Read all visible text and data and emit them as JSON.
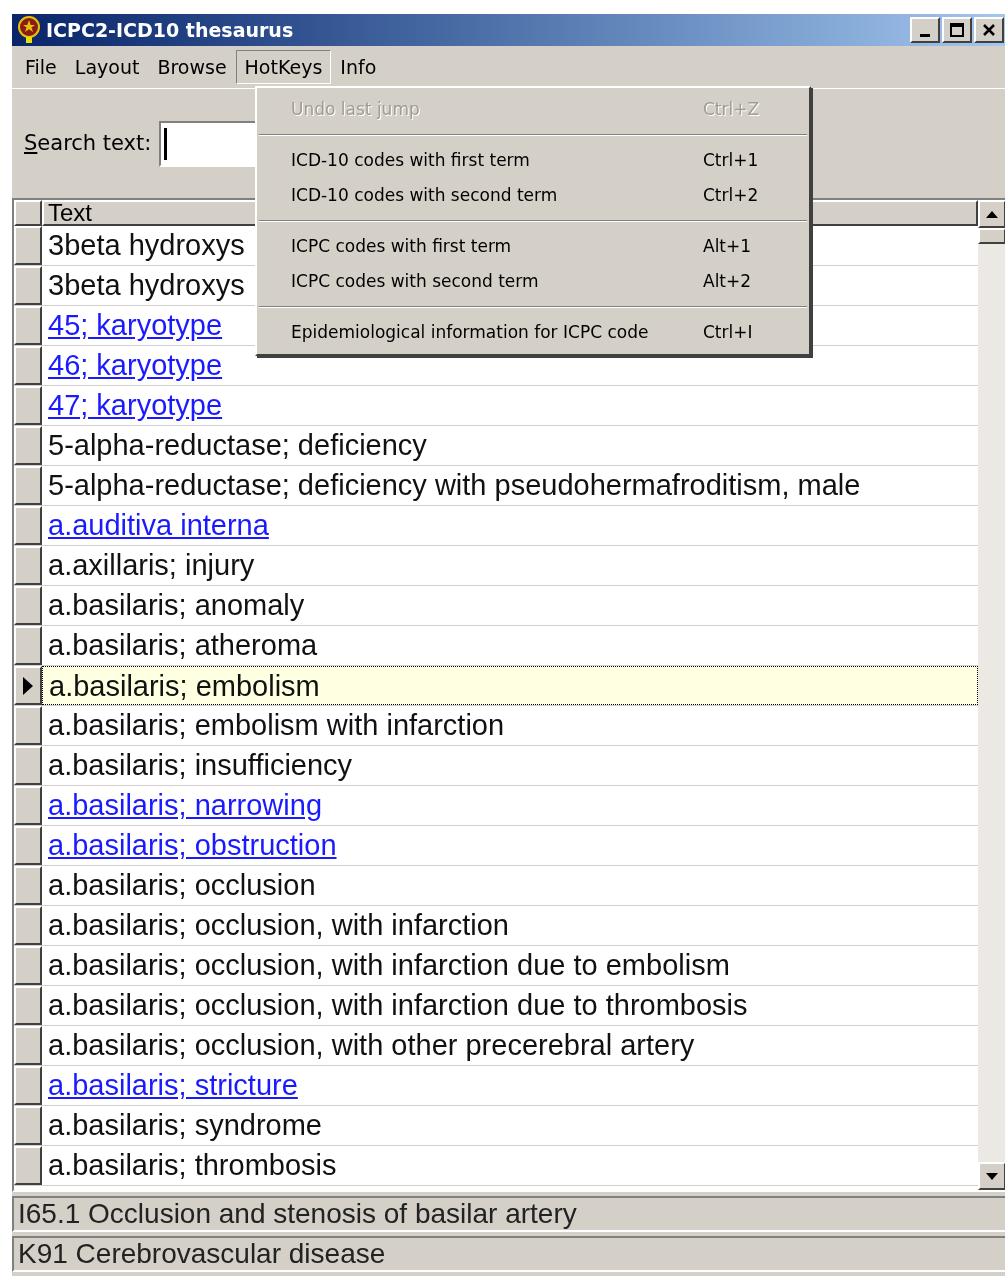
{
  "window": {
    "title": "ICPC2-ICD10 thesaurus"
  },
  "menu_bar": [
    {
      "label": "File",
      "selected": false
    },
    {
      "label": "Layout",
      "selected": false
    },
    {
      "label": "Browse",
      "selected": false
    },
    {
      "label": "HotKeys",
      "selected": true
    },
    {
      "label": "Info",
      "selected": false
    }
  ],
  "hotkeys_menu": [
    {
      "kind": "item",
      "label": "Undo last jump",
      "shortcut": "Ctrl+Z",
      "disabled": true
    },
    {
      "kind": "separator"
    },
    {
      "kind": "item",
      "label": "ICD-10 codes with first term",
      "shortcut": "Ctrl+1",
      "disabled": false
    },
    {
      "kind": "item",
      "label": "ICD-10 codes with second term",
      "shortcut": "Ctrl+2",
      "disabled": false
    },
    {
      "kind": "separator"
    },
    {
      "kind": "item",
      "label": "ICPC codes with first term",
      "shortcut": "Alt+1",
      "disabled": false
    },
    {
      "kind": "item",
      "label": "ICPC codes with second term",
      "shortcut": "Alt+2",
      "disabled": false
    },
    {
      "kind": "separator"
    },
    {
      "kind": "item",
      "label": "Epidemiological information for ICPC code",
      "shortcut": "Ctrl+I",
      "disabled": false
    }
  ],
  "search": {
    "label_accel": "S",
    "label_rest": "earch text:"
  },
  "table": {
    "columns": [
      "Text"
    ],
    "rows": [
      {
        "text": "3beta hydroxys",
        "kind": "plain",
        "selected": false
      },
      {
        "text": "3beta hydroxys",
        "kind": "plain",
        "selected": false
      },
      {
        "text": "45; karyotype",
        "kind": "link",
        "selected": false
      },
      {
        "text": "46; karyotype",
        "kind": "link",
        "selected": false
      },
      {
        "text": "47; karyotype",
        "kind": "link",
        "selected": false
      },
      {
        "text": "5-alpha-reductase; deficiency",
        "kind": "plain",
        "selected": false
      },
      {
        "text": "5-alpha-reductase; deficiency with pseudohermafroditism, male",
        "kind": "plain",
        "selected": false
      },
      {
        "text": "a.auditiva interna",
        "kind": "link",
        "selected": false
      },
      {
        "text": "a.axillaris; injury",
        "kind": "plain",
        "selected": false
      },
      {
        "text": "a.basilaris; anomaly",
        "kind": "plain",
        "selected": false
      },
      {
        "text": "a.basilaris; atheroma",
        "kind": "plain",
        "selected": false
      },
      {
        "text": "a.basilaris; embolism",
        "kind": "plain",
        "selected": true
      },
      {
        "text": "a.basilaris; embolism with infarction",
        "kind": "plain",
        "selected": false
      },
      {
        "text": "a.basilaris; insufficiency",
        "kind": "plain",
        "selected": false
      },
      {
        "text": "a.basilaris; narrowing",
        "kind": "link",
        "selected": false
      },
      {
        "text": "a.basilaris; obstruction",
        "kind": "link",
        "selected": false
      },
      {
        "text": "a.basilaris; occlusion",
        "kind": "plain",
        "selected": false
      },
      {
        "text": "a.basilaris; occlusion, with infarction",
        "kind": "plain",
        "selected": false
      },
      {
        "text": "a.basilaris; occlusion, with infarction due to embolism",
        "kind": "plain",
        "selected": false
      },
      {
        "text": "a.basilaris; occlusion, with infarction due to thrombosis",
        "kind": "plain",
        "selected": false
      },
      {
        "text": "a.basilaris; occlusion, with other precerebral artery",
        "kind": "plain",
        "selected": false
      },
      {
        "text": "a.basilaris; stricture",
        "kind": "link",
        "selected": false
      },
      {
        "text": "a.basilaris; syndrome",
        "kind": "plain",
        "selected": false
      },
      {
        "text": "a.basilaris; thrombosis",
        "kind": "plain",
        "selected": false
      }
    ]
  },
  "status_lines": [
    "I65.1 Occlusion and stenosis of basilar artery",
    "K91 Cerebrovascular disease"
  ]
}
